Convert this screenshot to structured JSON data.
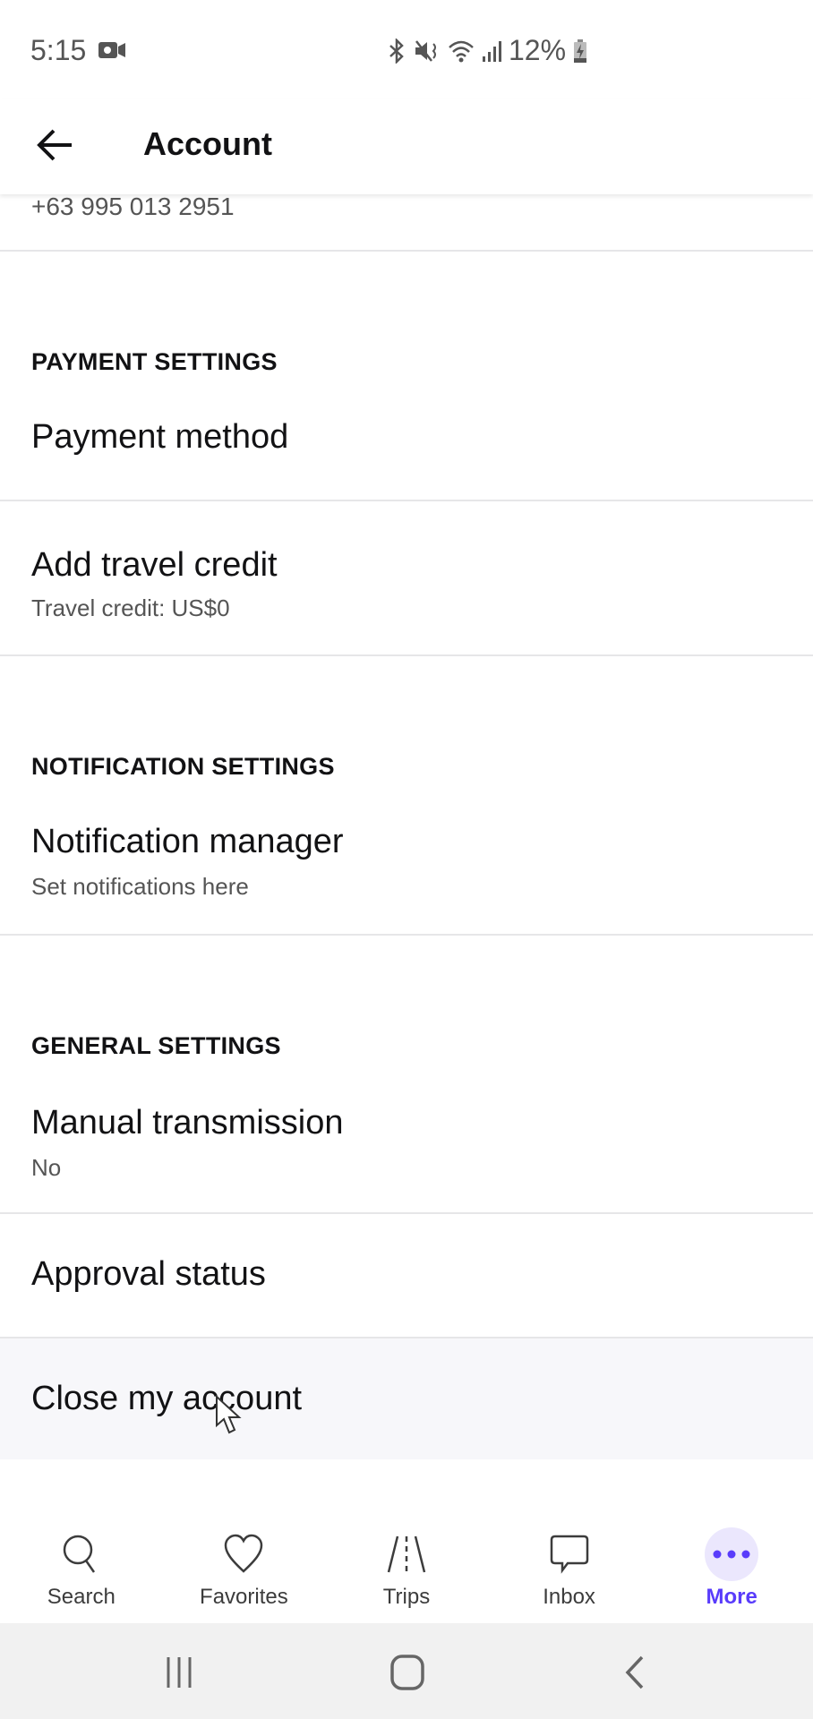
{
  "status_bar": {
    "time": "5:15",
    "battery": "12%",
    "icons": [
      "video-camera-icon",
      "bluetooth-icon",
      "mute-icon",
      "wifi-icon",
      "signal-icon",
      "battery-charging-icon"
    ]
  },
  "header": {
    "title": "Account",
    "back_icon": "arrow-left-icon"
  },
  "phone": "+63 995 013 2951",
  "sections": [
    {
      "title": "PAYMENT SETTINGS",
      "items": [
        {
          "title": "Payment method",
          "subtitle": ""
        },
        {
          "title": "Add travel credit",
          "subtitle": "Travel credit: US$0"
        }
      ]
    },
    {
      "title": "NOTIFICATION SETTINGS",
      "items": [
        {
          "title": "Notification manager",
          "subtitle": "Set notifications here"
        }
      ]
    },
    {
      "title": "GENERAL SETTINGS",
      "items": [
        {
          "title": "Manual transmission",
          "subtitle": "No"
        },
        {
          "title": "Approval status",
          "subtitle": ""
        },
        {
          "title": "Close my account",
          "subtitle": ""
        }
      ]
    }
  ],
  "bottom_nav": {
    "items": [
      {
        "label": "Search",
        "icon": "search-icon",
        "active": false
      },
      {
        "label": "Favorites",
        "icon": "heart-icon",
        "active": false
      },
      {
        "label": "Trips",
        "icon": "road-icon",
        "active": false
      },
      {
        "label": "Inbox",
        "icon": "chat-bubble-icon",
        "active": false
      },
      {
        "label": "More",
        "icon": "more-dots-icon",
        "active": true
      }
    ],
    "active_color": "#593cfb"
  },
  "system_nav": [
    "recent-apps",
    "home",
    "back"
  ]
}
